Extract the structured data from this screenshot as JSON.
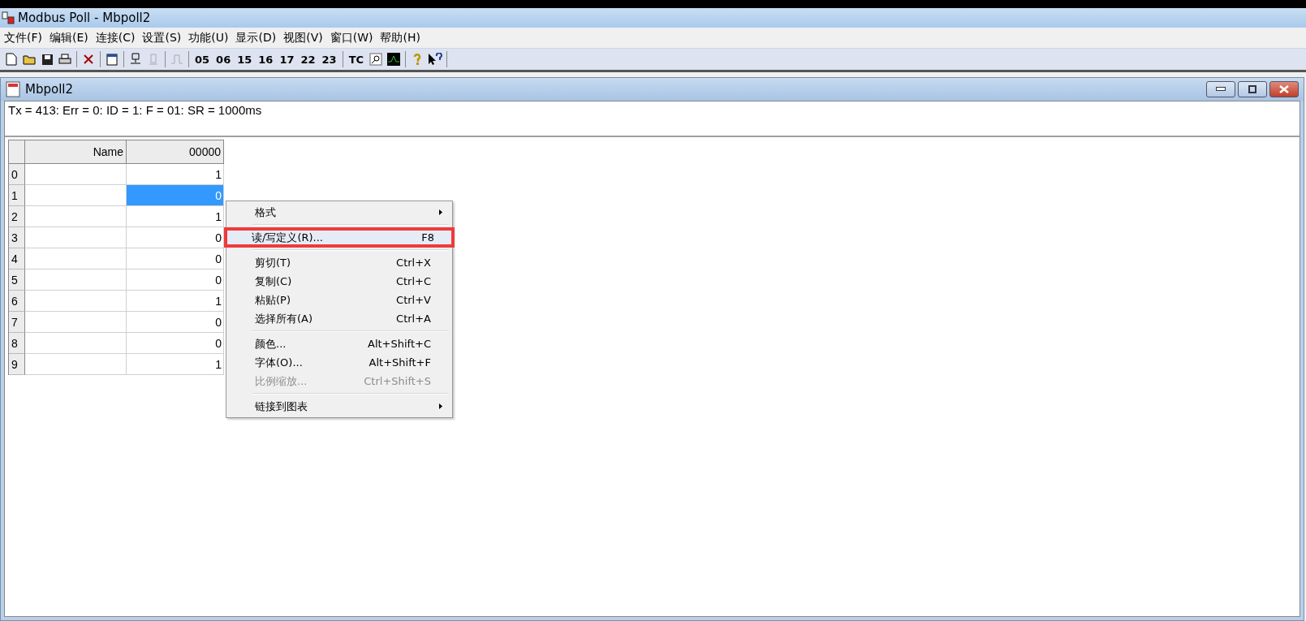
{
  "window": {
    "title": "Modbus Poll - Mbpoll2"
  },
  "menu": [
    "文件(F)",
    "编辑(E)",
    "连接(C)",
    "设置(S)",
    "功能(U)",
    "显示(D)",
    "视图(V)",
    "窗口(W)",
    "帮助(H)"
  ],
  "toolbar": [
    {
      "kind": "new"
    },
    {
      "kind": "open"
    },
    {
      "kind": "save"
    },
    {
      "kind": "print"
    },
    {
      "kind": "sep"
    },
    {
      "kind": "delete"
    },
    {
      "kind": "sep"
    },
    {
      "kind": "window"
    },
    {
      "kind": "sep"
    },
    {
      "kind": "connect"
    },
    {
      "kind": "disconnect",
      "disabled": true
    },
    {
      "kind": "sep"
    },
    {
      "kind": "pulse",
      "disabled": true
    },
    {
      "kind": "sep"
    },
    {
      "kind": "text",
      "label": "05"
    },
    {
      "kind": "text",
      "label": "06"
    },
    {
      "kind": "text",
      "label": "15"
    },
    {
      "kind": "text",
      "label": "16"
    },
    {
      "kind": "text",
      "label": "17"
    },
    {
      "kind": "text",
      "label": "22"
    },
    {
      "kind": "text",
      "label": "23"
    },
    {
      "kind": "sep"
    },
    {
      "kind": "text",
      "label": "TC"
    },
    {
      "kind": "search"
    },
    {
      "kind": "chart"
    },
    {
      "kind": "sep"
    },
    {
      "kind": "help"
    },
    {
      "kind": "whatsthis"
    },
    {
      "kind": "sep"
    }
  ],
  "child_window": {
    "title": "Mbpoll2",
    "status": "Tx = 413: Err = 0: ID = 1: F = 01: SR = 1000ms",
    "table": {
      "columns": [
        "Name",
        "00000"
      ],
      "rows": [
        {
          "index": "0",
          "value": "1",
          "selected": false
        },
        {
          "index": "1",
          "value": "0",
          "selected": true
        },
        {
          "index": "2",
          "value": "1",
          "selected": false
        },
        {
          "index": "3",
          "value": "0",
          "selected": false
        },
        {
          "index": "4",
          "value": "0",
          "selected": false
        },
        {
          "index": "5",
          "value": "0",
          "selected": false
        },
        {
          "index": "6",
          "value": "1",
          "selected": false
        },
        {
          "index": "7",
          "value": "0",
          "selected": false
        },
        {
          "index": "8",
          "value": "0",
          "selected": false
        },
        {
          "index": "9",
          "value": "1",
          "selected": false
        }
      ]
    }
  },
  "context_menu": [
    {
      "kind": "item",
      "label": "格式",
      "submenu": true,
      "disabled": false,
      "highlighted": false
    },
    {
      "kind": "separator"
    },
    {
      "kind": "item",
      "label": "读/写定义(R)...",
      "shortcut": "F8",
      "submenu": false,
      "disabled": false,
      "highlighted": true
    },
    {
      "kind": "separator"
    },
    {
      "kind": "item",
      "label": "剪切(T)",
      "shortcut": "Ctrl+X",
      "submenu": false,
      "disabled": false,
      "highlighted": false
    },
    {
      "kind": "item",
      "label": "复制(C)",
      "shortcut": "Ctrl+C",
      "submenu": false,
      "disabled": false,
      "highlighted": false
    },
    {
      "kind": "item",
      "label": "粘贴(P)",
      "shortcut": "Ctrl+V",
      "submenu": false,
      "disabled": false,
      "highlighted": false
    },
    {
      "kind": "item",
      "label": "选择所有(A)",
      "shortcut": "Ctrl+A",
      "submenu": false,
      "disabled": false,
      "highlighted": false
    },
    {
      "kind": "separator"
    },
    {
      "kind": "item",
      "label": "颜色...",
      "shortcut": "Alt+Shift+C",
      "submenu": false,
      "disabled": false,
      "highlighted": false
    },
    {
      "kind": "item",
      "label": "字体(O)...",
      "shortcut": "Alt+Shift+F",
      "submenu": false,
      "disabled": false,
      "highlighted": false
    },
    {
      "kind": "item",
      "label": "比例缩放...",
      "shortcut": "Ctrl+Shift+S",
      "submenu": false,
      "disabled": true,
      "highlighted": false
    },
    {
      "kind": "separator"
    },
    {
      "kind": "item",
      "label": "链接到图表",
      "submenu": true,
      "disabled": false,
      "highlighted": false
    }
  ]
}
